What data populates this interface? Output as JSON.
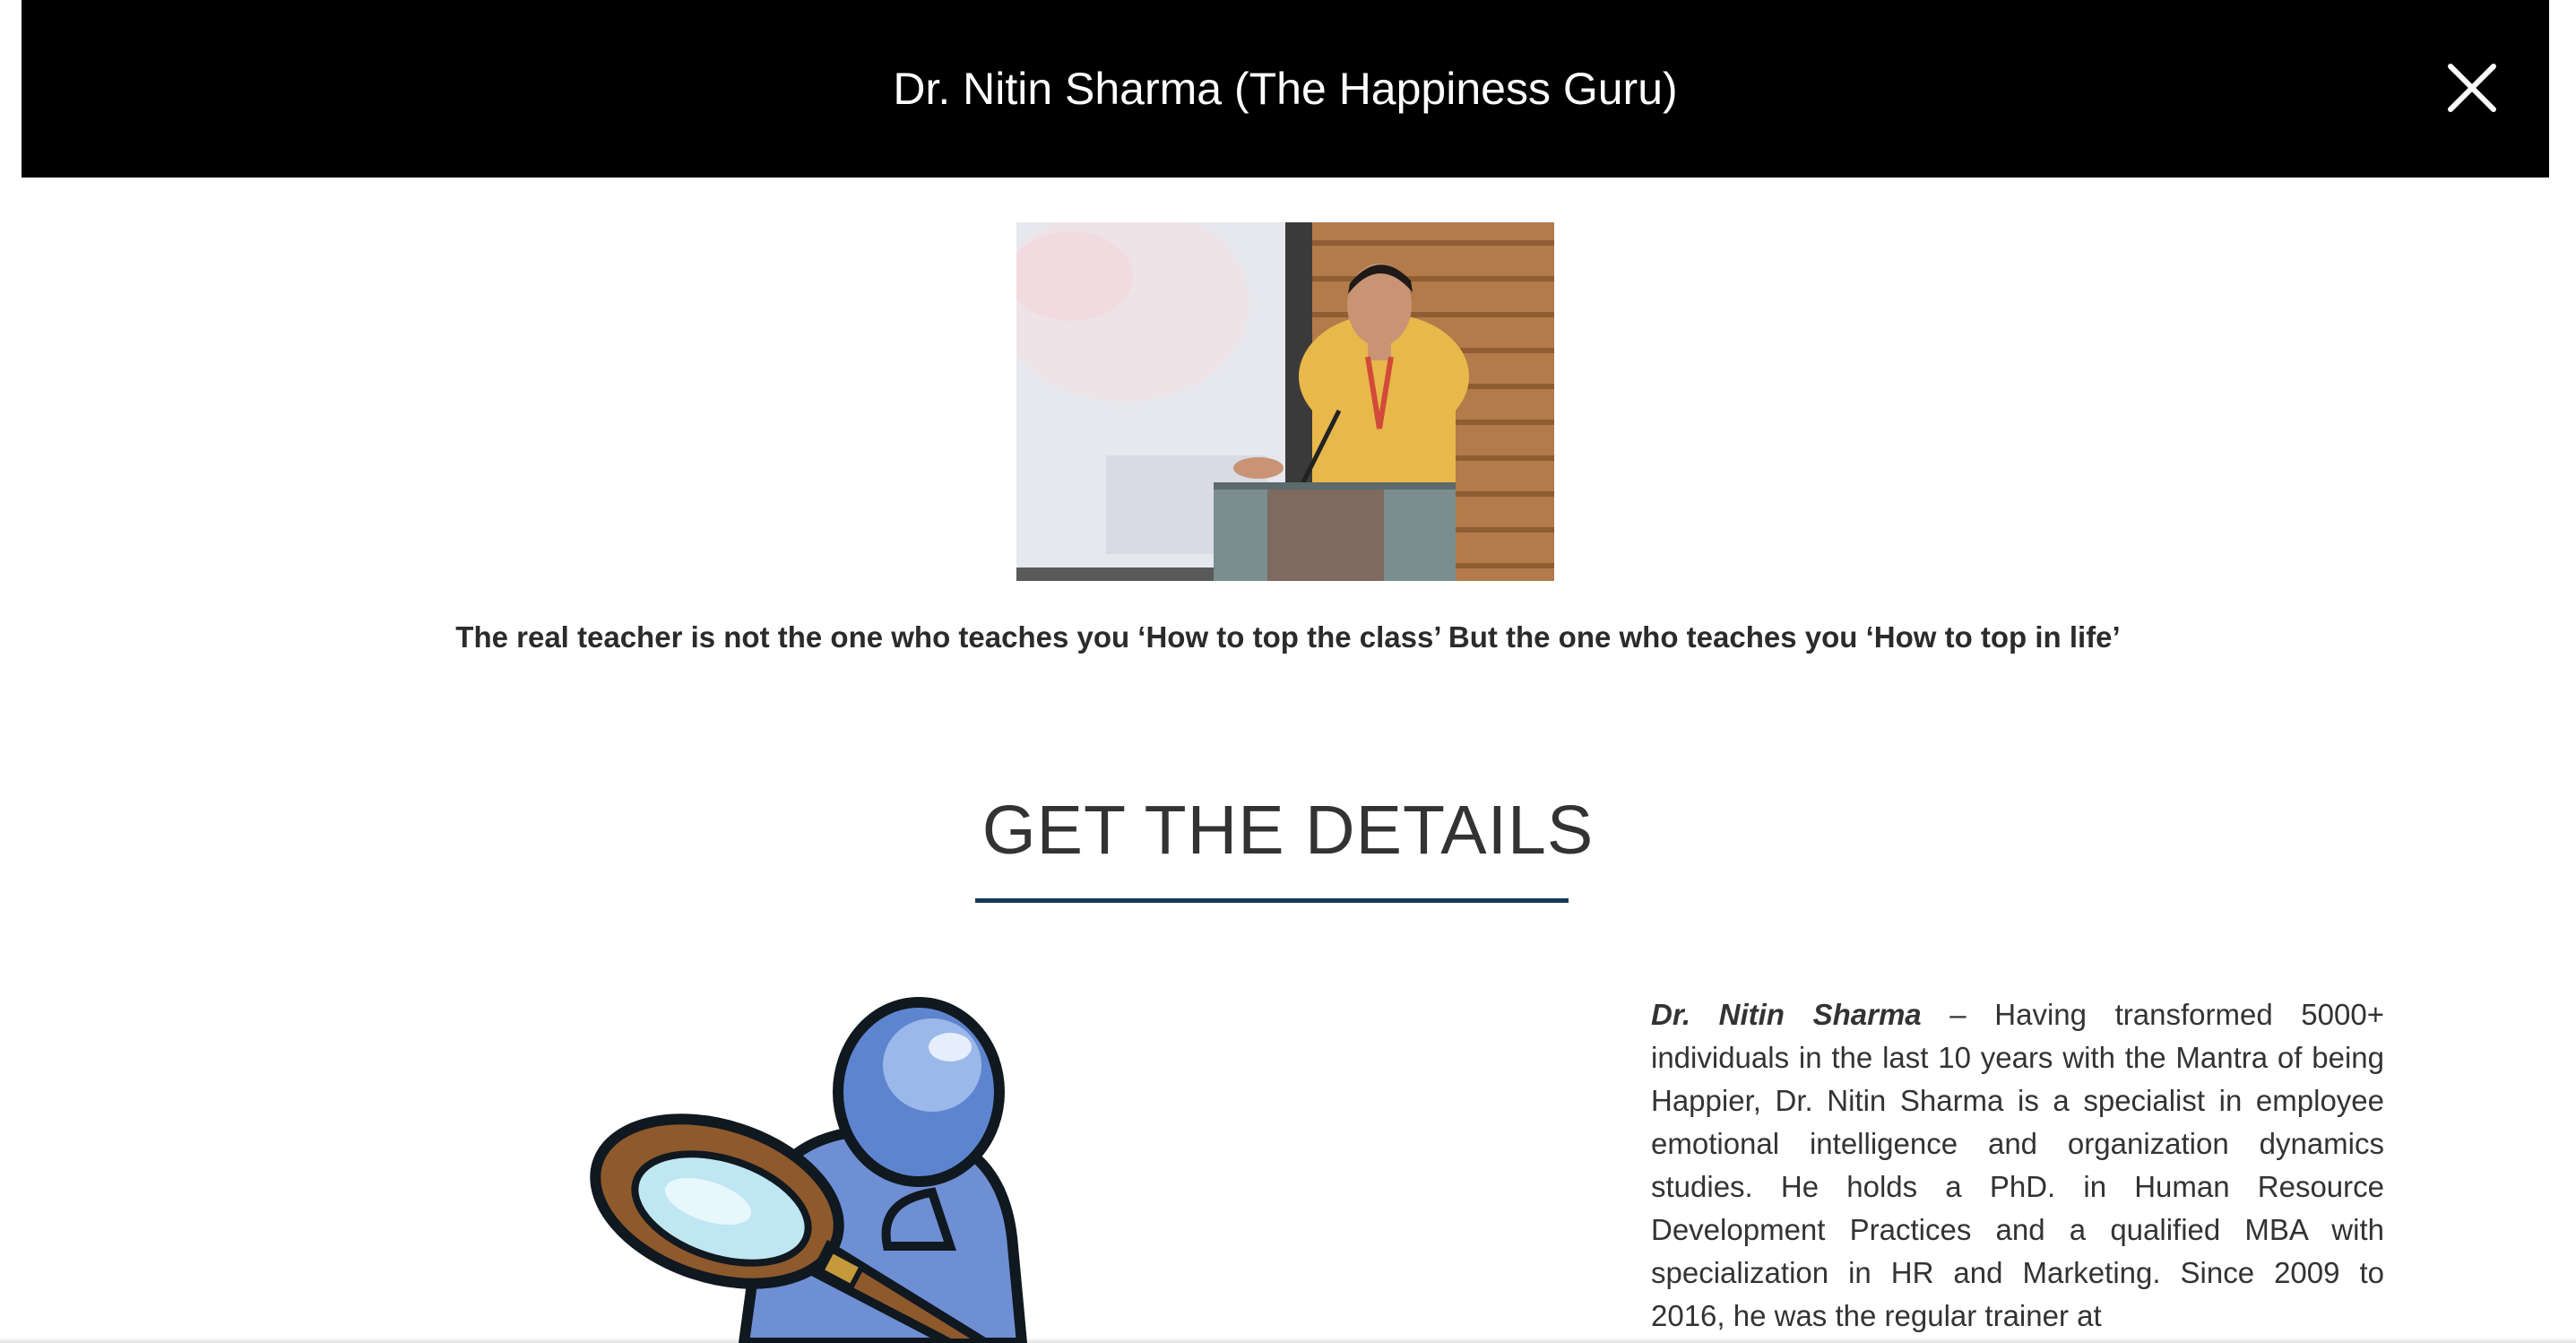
{
  "modal": {
    "title": "Dr. Nitin Sharma (The Happiness Guru)",
    "close_icon": "close-icon"
  },
  "speaker_photo": {
    "icon": "speaker-photo"
  },
  "quote": "The real teacher is not the one who teaches you ‘How to top the class’ But the one who teaches you ‘How to top in life’",
  "section": {
    "heading": "GET THE DETAILS"
  },
  "illustration": {
    "icon": "magnifying-glass-person-icon"
  },
  "bio": {
    "name": "Dr. Nitin Sharma",
    "text": " – Having transformed 5000+ individuals in the last 10 years with the Mantra of being Happier, Dr. Nitin Sharma is a specialist in employee emotional intelligence and organization dynamics studies. He holds a PhD. in Human Resource Development Practices and a qualified MBA with specialization in HR and Marketing. Since 2009 to 2016, he was the regular trainer at"
  },
  "colors": {
    "header_bg": "#000000",
    "header_text": "#ffffff",
    "underline": "#123a5c",
    "body_text": "#333333"
  }
}
